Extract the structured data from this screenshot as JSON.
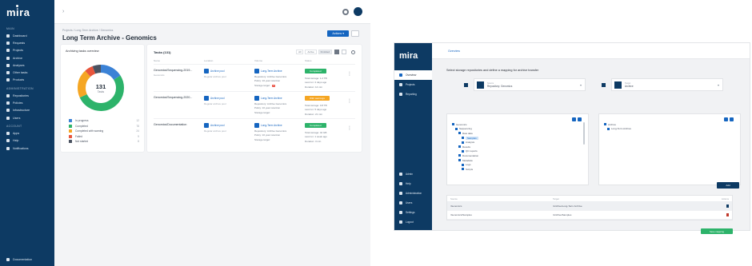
{
  "screen1": {
    "logo": "mira",
    "sidebar": {
      "section_main": "MAIN",
      "items_main": [
        "Dashboard",
        "Requests",
        "Projects",
        "Archive",
        "Analyses",
        "Other tasks",
        "Products"
      ],
      "section_admin": "ADMINISTRATION",
      "items_admin": [
        "Repositories",
        "Policies",
        "Infrastructure",
        "Users"
      ],
      "section_account": "ACCOUNT",
      "items_account": [
        "Apps",
        "Help",
        "Notifications"
      ],
      "bottom": "Documentation"
    },
    "breadcrumb": "Projects / Long-Term Archive / Genomics",
    "page_title": "Long Term Archive - Genomics",
    "actions_label": "Actions ▾",
    "donut_card": {
      "title": "Archiving tasks overview",
      "center_value": "131",
      "center_label": "Tasks",
      "legend": [
        {
          "name": "In progress",
          "value": "12",
          "color": "#3b82d6"
        },
        {
          "name": "Completed",
          "value": "78",
          "color": "#2db36a"
        },
        {
          "name": "Completed with warning",
          "value": "24",
          "color": "#f5a623"
        },
        {
          "name": "Failed",
          "value": "9",
          "color": "#e8553c"
        },
        {
          "name": "Not started",
          "value": "8",
          "color": "#4a5260"
        }
      ],
      "segments": [
        {
          "name": "In progress",
          "fraction": 0.16,
          "color": "#3b82d6"
        },
        {
          "name": "Completed",
          "fraction": 0.52,
          "color": "#2db36a"
        },
        {
          "name": "Completed with warning",
          "fraction": 0.2,
          "color": "#f5a623"
        },
        {
          "name": "Failed",
          "fraction": 0.06,
          "color": "#e8553c"
        },
        {
          "name": "Not started",
          "fraction": 0.06,
          "color": "#4a5260"
        }
      ]
    },
    "tasks_card": {
      "title": "Tasks (131)",
      "filters": [
        "All",
        "Active",
        "Finished"
      ],
      "columns": [
        "Name",
        "Location",
        "Volume",
        "Status"
      ],
      "rows": [
        {
          "name": "Genomics/Sequencing-2019...",
          "sub": "Genomics",
          "location": "Archive pool",
          "location_sub": "Regular archive pool",
          "volume": "Long-Term Archive",
          "vol_line1": "Repository: Archive Genomics",
          "vol_line2": "Policy: 10 year retention",
          "vol_line3": "Storage target:",
          "vol_badge": "2",
          "status": "Completed",
          "status_color": "green",
          "st_line1": "Total storage: 1.2 TB",
          "st_line2": "Last run: 2 days ago",
          "st_line3": "Duration: 14 min"
        },
        {
          "name": "Genomics/Sequencing-2020...",
          "sub": "",
          "location": "Archive pool",
          "location_sub": "Regular archive pool",
          "volume": "Long-Term Archive",
          "vol_line1": "Repository: Archive Genomics",
          "vol_line2": "Policy: 10 year retention",
          "vol_line3": "Storage target:",
          "vol_badge": "",
          "status": "With warnings",
          "status_color": "orange",
          "st_line1": "Total storage: 0.8 TB",
          "st_line2": "Last run: 5 days ago",
          "st_line3": "Duration: 21 min"
        },
        {
          "name": "Genomics/Documentation",
          "sub": "",
          "location": "Archive pool",
          "location_sub": "Regular archive pool",
          "volume": "Long-Term Archive",
          "vol_line1": "Repository: Archive Genomics",
          "vol_line2": "Policy: 10 year retention",
          "vol_line3": "Storage target:",
          "vol_badge": "",
          "status": "Completed",
          "status_color": "green",
          "st_line1": "Total storage: 42 GB",
          "st_line2": "Last run: 1 week ago",
          "st_line3": "Duration: 3 min"
        }
      ]
    }
  },
  "screen2": {
    "logo": "mira",
    "sidebar_top": [
      "Overview",
      "Projects",
      "Reporting"
    ],
    "sidebar_bottom": [
      "Admin",
      "Help",
      "Administration",
      "Users",
      "Settings",
      "Logout"
    ],
    "breadcrumb": "Overview",
    "instruction": "Select storage repositories and define a mapping for archive transfer",
    "source": {
      "label": "Source",
      "value": "Repository: Genomics"
    },
    "target": {
      "label": "Target",
      "value": "Archive"
    },
    "tree_left": [
      "Genomics",
      "Sequencing",
      "Raw data",
      "Samples",
      "Analysis",
      "Results",
      "QC reports",
      "Documentation",
      "Metadata",
      "Logs",
      "Scripts"
    ],
    "tree_left_selected": "Samples",
    "tree_right": [
      "Archive",
      "Long-Term Archive"
    ],
    "add_label": "Add",
    "table": {
      "columns": [
        "Source",
        "Target",
        "Actions"
      ],
      "rows": [
        {
          "source": "/Genomics",
          "target": "/Archive/Long-Term Archive"
        },
        {
          "source": "/Genomics/Samples",
          "target": "/Archive/Samples"
        }
      ]
    },
    "save_label": "Save mapping"
  }
}
